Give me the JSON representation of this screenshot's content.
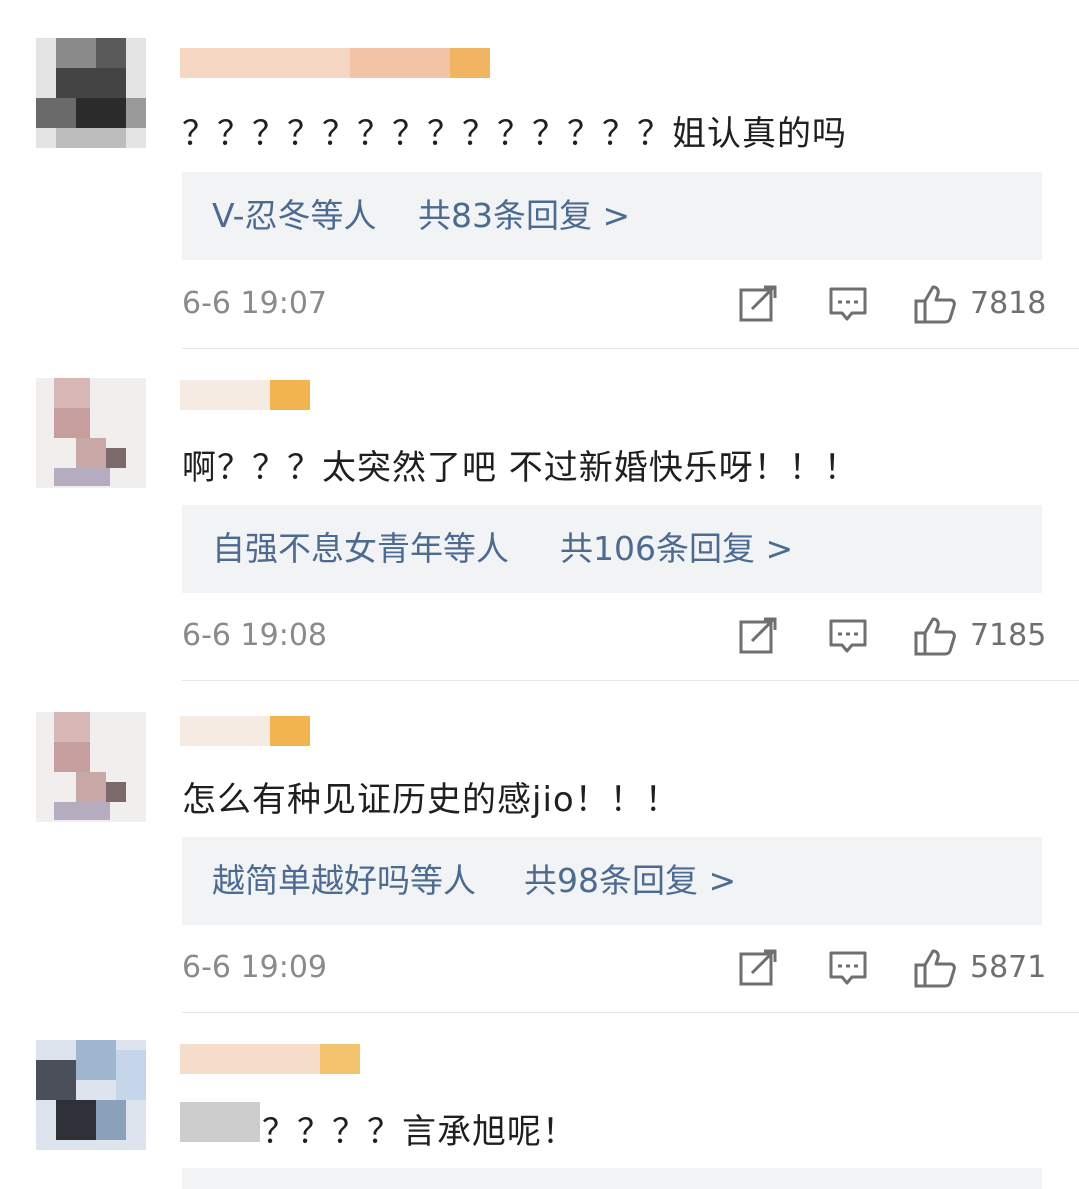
{
  "comments": [
    {
      "text": "？？？？？？？？？？？？？？姐认真的吗",
      "replies": {
        "who": "V-忍冬等人",
        "count": "共83条回复 >"
      },
      "time": "6-6 19:07",
      "likes": "7818"
    },
    {
      "text": "啊？？？太突然了吧 不过新婚快乐呀！！！",
      "replies": {
        "who": "自强不息女青年等人",
        "count": "共106条回复 >"
      },
      "time": "6-6 19:08",
      "likes": "7185"
    },
    {
      "text": "怎么有种见证历史的感jio！！！",
      "replies": {
        "who": "越简单越好吗等人",
        "count": "共98条回复 >"
      },
      "time": "6-6 19:09",
      "likes": "5871"
    },
    {
      "text": "？？？？言承旭呢！"
    }
  ],
  "icons": {
    "share": "share-icon",
    "comment": "comment-icon",
    "like": "thumbs-up-icon"
  },
  "colors": {
    "reply_link": "#4d6b91",
    "reply_bg": "#f2f3f5",
    "meta": "#8a8a8a"
  }
}
